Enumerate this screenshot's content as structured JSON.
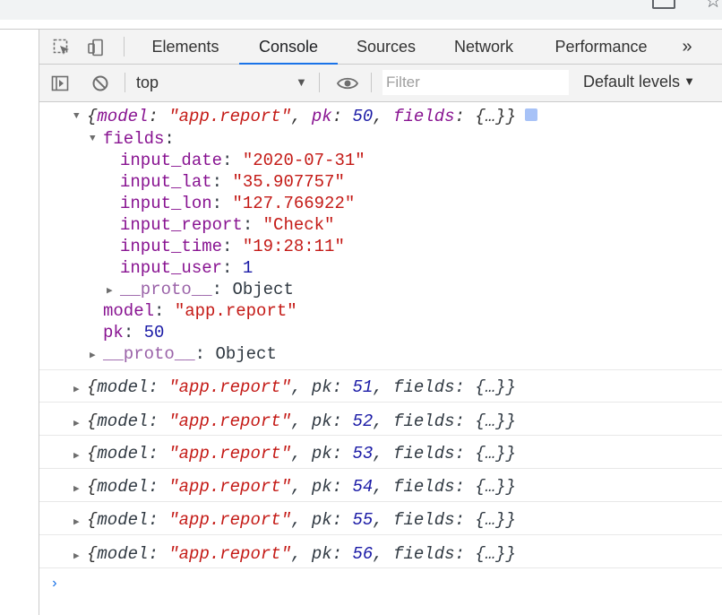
{
  "tabs": [
    "Elements",
    "Console",
    "Sources",
    "Network",
    "Performance"
  ],
  "more_tabs": "»",
  "toolbar": {
    "context": "top",
    "filter_placeholder": "Filter",
    "levels": "Default levels"
  },
  "expanded_entry": {
    "summary": {
      "open": "{",
      "model_key": "model",
      "model_val": "\"app.report\"",
      "pk_key": "pk",
      "pk_val": "50",
      "fields_key": "fields",
      "fields_val": "{…}",
      "close": "}"
    },
    "fields_label": "fields",
    "fields": [
      {
        "key": "input_date",
        "value": "\"2020-07-31\"",
        "type": "string"
      },
      {
        "key": "input_lat",
        "value": "\"35.907757\"",
        "type": "string"
      },
      {
        "key": "input_lon",
        "value": "\"127.766922\"",
        "type": "string"
      },
      {
        "key": "input_report",
        "value": "\"Check\"",
        "type": "string"
      },
      {
        "key": "input_time",
        "value": "\"19:28:11\"",
        "type": "string"
      },
      {
        "key": "input_user",
        "value": "1",
        "type": "number"
      }
    ],
    "fields_proto": {
      "key": "__proto__",
      "value": "Object"
    },
    "model": {
      "key": "model",
      "value": "\"app.report\""
    },
    "pk": {
      "key": "pk",
      "value": "50"
    },
    "proto": {
      "key": "__proto__",
      "value": "Object"
    }
  },
  "collapsed_entries": [
    {
      "model": "\"app.report\"",
      "pk": "51",
      "fields": "{…}"
    },
    {
      "model": "\"app.report\"",
      "pk": "52",
      "fields": "{…}"
    },
    {
      "model": "\"app.report\"",
      "pk": "53",
      "fields": "{…}"
    },
    {
      "model": "\"app.report\"",
      "pk": "54",
      "fields": "{…}"
    },
    {
      "model": "\"app.report\"",
      "pk": "55",
      "fields": "{…}"
    },
    {
      "model": "\"app.report\"",
      "pk": "56",
      "fields": "{…}"
    }
  ],
  "prompt_symbol": "›",
  "colors": {
    "accent": "#1a73e8",
    "string": "#c41a16",
    "number": "#1a1aa6",
    "key": "#881391"
  }
}
